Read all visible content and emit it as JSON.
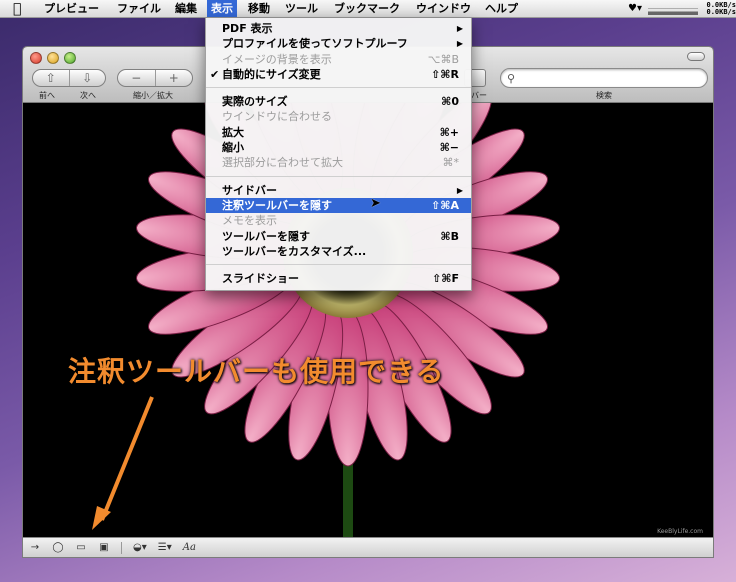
{
  "menubar": {
    "app_name": "プレビュー",
    "items": [
      "ファイル",
      "編集",
      "表示",
      "移動",
      "ツール",
      "ブックマーク",
      "ウインドウ",
      "ヘルプ"
    ],
    "net_up": "0.0KB/s",
    "net_down": "0.0KB/s"
  },
  "toolbar": {
    "prev_label": "前へ",
    "next_label": "次へ",
    "zoom_label": "縮小／拡大",
    "sidebar_label": "バー",
    "search_label": "検索",
    "zoom_out_glyph": "−",
    "zoom_in_glyph": "+"
  },
  "view_menu": {
    "items": [
      {
        "label": "PDF 表示",
        "shortcut": "",
        "submenu": true,
        "disabled": false
      },
      {
        "label": "プロファイルを使ってソフトプルーフ",
        "shortcut": "",
        "submenu": true,
        "disabled": false
      },
      {
        "label": "イメージの背景を表示",
        "shortcut": "⌥⌘B",
        "submenu": false,
        "disabled": true
      },
      {
        "label": "自動的にサイズ変更",
        "shortcut": "⇧⌘R",
        "submenu": false,
        "disabled": false,
        "checked": true
      },
      {
        "label": "実際のサイズ",
        "shortcut": "⌘0",
        "submenu": false,
        "disabled": false
      },
      {
        "label": "ウインドウに合わせる",
        "shortcut": "",
        "submenu": false,
        "disabled": true
      },
      {
        "label": "拡大",
        "shortcut": "⌘+",
        "submenu": false,
        "disabled": false
      },
      {
        "label": "縮小",
        "shortcut": "⌘−",
        "submenu": false,
        "disabled": false
      },
      {
        "label": "選択部分に合わせて拡大",
        "shortcut": "⌘*",
        "submenu": false,
        "disabled": true
      },
      {
        "label": "サイドバー",
        "shortcut": "",
        "submenu": true,
        "disabled": false
      },
      {
        "label": "注釈ツールバーを隠す",
        "shortcut": "⇧⌘A",
        "submenu": false,
        "disabled": false,
        "selected": true
      },
      {
        "label": "メモを表示",
        "shortcut": "",
        "submenu": false,
        "disabled": true
      },
      {
        "label": "ツールバーを隠す",
        "shortcut": "⌘B",
        "submenu": false,
        "disabled": false
      },
      {
        "label": "ツールバーをカスタマイズ...",
        "shortcut": "",
        "submenu": false,
        "disabled": false
      },
      {
        "label": "スライドショー",
        "shortcut": "⇧⌘F",
        "submenu": false,
        "disabled": false
      }
    ],
    "checkmark": "✔",
    "submenu_arrow": "▶"
  },
  "caption": "注釈ツールバーも使用できる",
  "watermark": "KeeBlyLife.com",
  "annotation_toolbar": {
    "items": [
      "arrow-tool-icon",
      "oval-tool-icon",
      "rectangle-tool-icon",
      "text-box-tool-icon",
      "color-picker-icon",
      "line-style-icon",
      "font-icon"
    ],
    "font_label": "Aa"
  },
  "colors": {
    "menu_highlight": "#3468d6",
    "caption": "#f28b2e",
    "arrow": "#f28b2e"
  }
}
